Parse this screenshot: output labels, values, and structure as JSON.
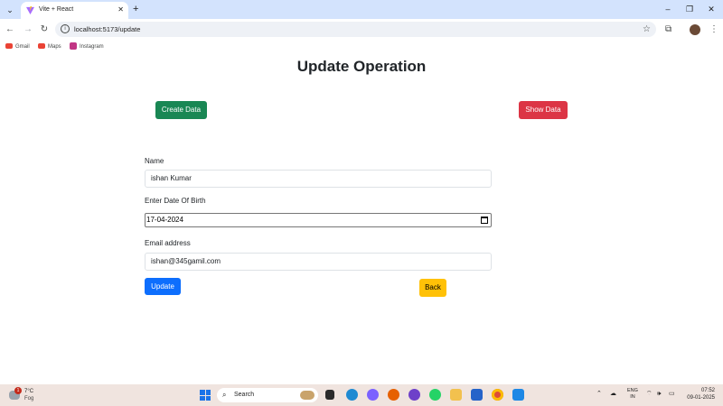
{
  "browser": {
    "tab_title": "Vite + React",
    "tab_close": "✕",
    "new_tab": "+",
    "url": "localhost:5173/update",
    "window_controls": {
      "minimize": "–",
      "restore": "❐",
      "close": "✕"
    },
    "bookmarks": [
      {
        "label": "Gmail",
        "color": "#ea4335"
      },
      {
        "label": "Maps",
        "color": "#ea4335"
      },
      {
        "label": "Instagram",
        "color": "#c13584"
      }
    ]
  },
  "page": {
    "title": "Update Operation",
    "create_button": "Create Data",
    "show_button": "Show Data",
    "form": {
      "name_label": "Name",
      "name_value": "ishan Kumar",
      "dob_label": "Enter Date Of Birth",
      "dob_value": "17-04-2024",
      "email_label": "Email address",
      "email_value": "ishan@345gamil.com",
      "update_button": "Update",
      "back_button": "Back"
    }
  },
  "taskbar": {
    "weather_badge": "1",
    "temperature": "7°C",
    "condition": "Fog",
    "search_label": "Search",
    "lang_line1": "ENG",
    "lang_line2": "IN",
    "time": "07:52",
    "date": "09-01-2025"
  },
  "colors": {
    "create": "#198754",
    "show": "#dc3545",
    "update": "#0d6efd",
    "back": "#ffc107",
    "tabbar": "#d3e3fd"
  }
}
